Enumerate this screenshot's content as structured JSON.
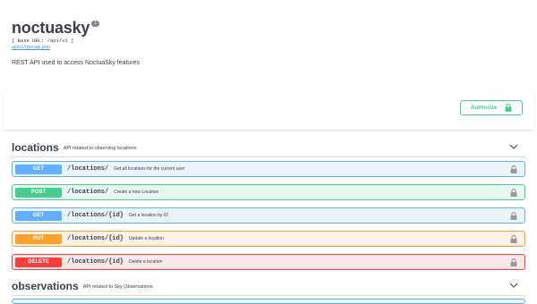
{
  "info": {
    "title": "noctuasky",
    "version": "1",
    "base_url": "[ Base URL: /api/v1 ]",
    "spec_link": "api/v1/openapi.json",
    "description": "REST API used to access NoctuaSky features"
  },
  "authorize": {
    "label": "Authorize",
    "icon": "lock-icon",
    "color": "#49cc90"
  },
  "tags": [
    {
      "name": "locations",
      "description": "API related to observing locations",
      "operations": [
        {
          "method": "GET",
          "path": "/locations/",
          "summary": "Get all locations for the current user"
        },
        {
          "method": "POST",
          "path": "/locations/",
          "summary": "Create a new Location"
        },
        {
          "method": "GET",
          "path": "/locations/{id}",
          "summary": "Get a location by ID"
        },
        {
          "method": "PUT",
          "path": "/locations/{id}",
          "summary": "Update a location"
        },
        {
          "method": "DELETE",
          "path": "/locations/{id}",
          "summary": "Delete a location"
        }
      ]
    },
    {
      "name": "observations",
      "description": "API related to Sky Observations"
    }
  ],
  "colors": {
    "get": "#61affe",
    "post": "#49cc90",
    "put": "#fca130",
    "delete": "#f93e3e"
  }
}
